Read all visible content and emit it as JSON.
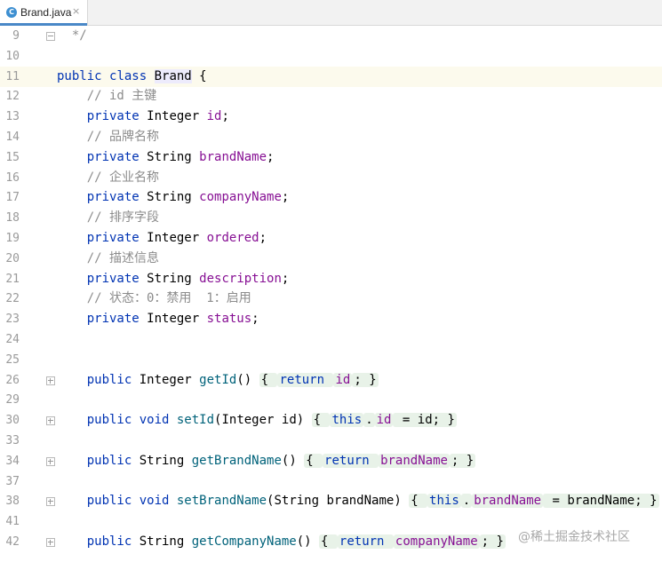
{
  "tab": {
    "label": "Brand.java",
    "icon": "C",
    "close": "×"
  },
  "watermark": "@稀土掘金技术社区",
  "lines": [
    {
      "n": "9",
      "code": [
        {
          "t": "  */",
          "c": "cm"
        }
      ]
    },
    {
      "n": "10",
      "code": []
    },
    {
      "n": "11",
      "code": [
        {
          "t": "public ",
          "c": "kw"
        },
        {
          "t": "class ",
          "c": "kw"
        },
        {
          "t": "Brand",
          "c": "hl"
        },
        {
          "t": " {",
          "c": ""
        }
      ]
    },
    {
      "n": "12",
      "code": [
        {
          "t": "    // id 主键",
          "c": "cm"
        }
      ]
    },
    {
      "n": "13",
      "code": [
        {
          "t": "    private ",
          "c": "kw"
        },
        {
          "t": "Integer ",
          "c": ""
        },
        {
          "t": "id",
          "c": "fld"
        },
        {
          "t": ";",
          "c": ""
        }
      ]
    },
    {
      "n": "14",
      "code": [
        {
          "t": "    // 品牌名称",
          "c": "cm"
        }
      ]
    },
    {
      "n": "15",
      "code": [
        {
          "t": "    private ",
          "c": "kw"
        },
        {
          "t": "String ",
          "c": ""
        },
        {
          "t": "brandName",
          "c": "fld"
        },
        {
          "t": ";",
          "c": ""
        }
      ]
    },
    {
      "n": "16",
      "code": [
        {
          "t": "    // 企业名称",
          "c": "cm"
        }
      ]
    },
    {
      "n": "17",
      "code": [
        {
          "t": "    private ",
          "c": "kw"
        },
        {
          "t": "String ",
          "c": ""
        },
        {
          "t": "companyName",
          "c": "fld"
        },
        {
          "t": ";",
          "c": ""
        }
      ]
    },
    {
      "n": "18",
      "code": [
        {
          "t": "    // 排序字段",
          "c": "cm"
        }
      ]
    },
    {
      "n": "19",
      "code": [
        {
          "t": "    private ",
          "c": "kw"
        },
        {
          "t": "Integer ",
          "c": ""
        },
        {
          "t": "ordered",
          "c": "fld"
        },
        {
          "t": ";",
          "c": ""
        }
      ]
    },
    {
      "n": "20",
      "code": [
        {
          "t": "    // 描述信息",
          "c": "cm"
        }
      ]
    },
    {
      "n": "21",
      "code": [
        {
          "t": "    private ",
          "c": "kw"
        },
        {
          "t": "String ",
          "c": ""
        },
        {
          "t": "description",
          "c": "fld"
        },
        {
          "t": ";",
          "c": ""
        }
      ]
    },
    {
      "n": "22",
      "code": [
        {
          "t": "    // 状态：0：禁用  1：启用",
          "c": "cm"
        }
      ]
    },
    {
      "n": "23",
      "code": [
        {
          "t": "    private ",
          "c": "kw"
        },
        {
          "t": "Integer ",
          "c": ""
        },
        {
          "t": "status",
          "c": "fld"
        },
        {
          "t": ";",
          "c": ""
        }
      ]
    },
    {
      "n": "24",
      "code": []
    },
    {
      "n": "25",
      "code": []
    },
    {
      "n": "26",
      "fold": true,
      "code": [
        {
          "t": "    public ",
          "c": "kw"
        },
        {
          "t": "Integer ",
          "c": ""
        },
        {
          "t": "getId",
          "c": "mth"
        },
        {
          "t": "() ",
          "c": ""
        },
        {
          "t": "{ ",
          "c": "fr"
        },
        {
          "t": "return ",
          "c": "kwfr"
        },
        {
          "t": "id",
          "c": "fldfr"
        },
        {
          "t": "; }",
          "c": "fr"
        }
      ]
    },
    {
      "n": "29",
      "code": []
    },
    {
      "n": "30",
      "fold": true,
      "code": [
        {
          "t": "    public ",
          "c": "kw"
        },
        {
          "t": "void ",
          "c": "kw"
        },
        {
          "t": "setId",
          "c": "mth"
        },
        {
          "t": "(Integer id) ",
          "c": ""
        },
        {
          "t": "{ ",
          "c": "fr"
        },
        {
          "t": "this",
          "c": "kwfr"
        },
        {
          "t": ".",
          "c": "fr"
        },
        {
          "t": "id",
          "c": "fldfr"
        },
        {
          "t": " = id; }",
          "c": "fr"
        }
      ]
    },
    {
      "n": "33",
      "code": []
    },
    {
      "n": "34",
      "fold": true,
      "code": [
        {
          "t": "    public ",
          "c": "kw"
        },
        {
          "t": "String ",
          "c": ""
        },
        {
          "t": "getBrandName",
          "c": "mth"
        },
        {
          "t": "() ",
          "c": ""
        },
        {
          "t": "{ ",
          "c": "fr"
        },
        {
          "t": "return ",
          "c": "kwfr"
        },
        {
          "t": "brandName",
          "c": "fldfr"
        },
        {
          "t": "; }",
          "c": "fr"
        }
      ]
    },
    {
      "n": "37",
      "code": []
    },
    {
      "n": "38",
      "fold": true,
      "code": [
        {
          "t": "    public ",
          "c": "kw"
        },
        {
          "t": "void ",
          "c": "kw"
        },
        {
          "t": "setBrandName",
          "c": "mth"
        },
        {
          "t": "(String brandName) ",
          "c": ""
        },
        {
          "t": "{ ",
          "c": "fr"
        },
        {
          "t": "this",
          "c": "kwfr"
        },
        {
          "t": ".",
          "c": "fr"
        },
        {
          "t": "brandName",
          "c": "fldfr"
        },
        {
          "t": " = brandName; }",
          "c": "fr"
        }
      ]
    },
    {
      "n": "41",
      "code": []
    },
    {
      "n": "42",
      "fold": true,
      "code": [
        {
          "t": "    public ",
          "c": "kw"
        },
        {
          "t": "String ",
          "c": ""
        },
        {
          "t": "getCompanyName",
          "c": "mth"
        },
        {
          "t": "() ",
          "c": ""
        },
        {
          "t": "{ ",
          "c": "fr"
        },
        {
          "t": "return ",
          "c": "kwfr"
        },
        {
          "t": "companyName",
          "c": "fldfr"
        },
        {
          "t": "; }",
          "c": "fr"
        }
      ]
    }
  ]
}
